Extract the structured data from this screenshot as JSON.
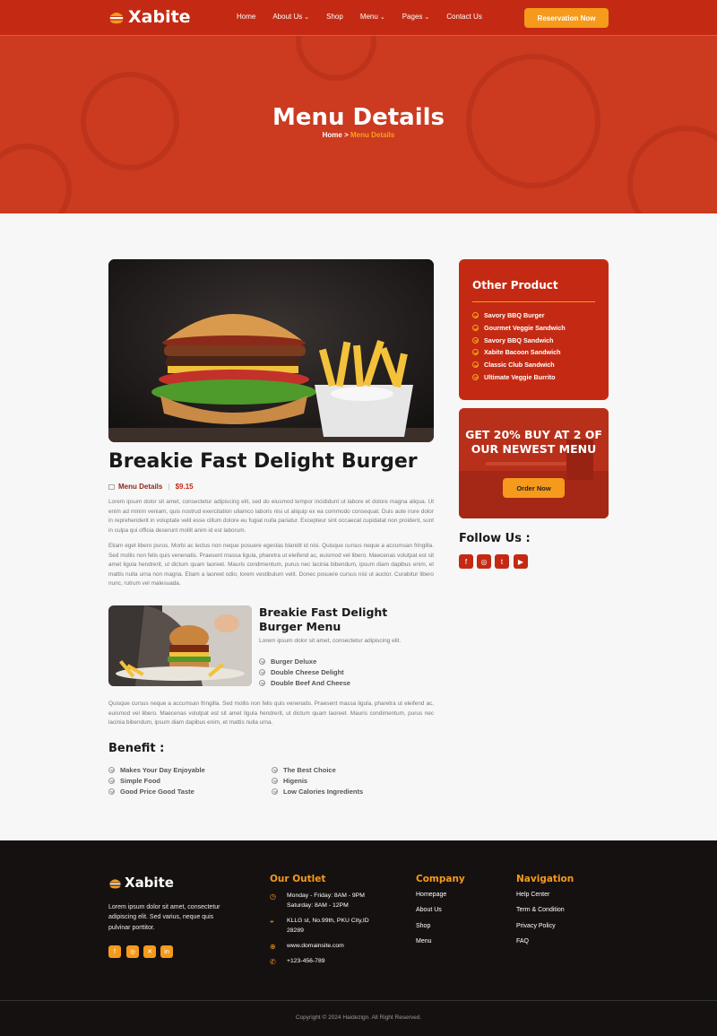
{
  "header": {
    "brand": "Xabite",
    "nav": [
      {
        "label": "Home",
        "dropdown": false
      },
      {
        "label": "About Us",
        "dropdown": true
      },
      {
        "label": "Shop",
        "dropdown": false
      },
      {
        "label": "Menu",
        "dropdown": true
      },
      {
        "label": "Pages",
        "dropdown": true
      },
      {
        "label": "Contact Us",
        "dropdown": false
      }
    ],
    "cta": "Reservation Now"
  },
  "hero": {
    "title": "Menu Details",
    "crumb_home": "Home",
    "crumb_sep": " > ",
    "crumb_current": "Menu Details"
  },
  "article": {
    "title": "Breakie Fast Delight Burger",
    "category": "Menu Details",
    "price": "$9.15",
    "para1": "Lorem ipsum dolor sit amet, consectetur adipiscing elit, sed do eiusmod tempor incididunt ut labore et dolore magna aliqua. Ut enim ad minim veniam, quis nostrud exercitation ullamco laboris nisi ut aliquip ex ea commodo consequat. Duis aute irure dolor in reprehenderit in voluptate velit esse cillum dolore eu fugiat nulla pariatur. Excepteur sint occaecat cupidatat non proident, sunt in culpa qui officia deserunt mollit anim id est laborum.",
    "para2": "Etiam eget libero purus. Morbi ac lectus non neque posuere egestas blandit id nisi. Quisque cursus neque a accumsan fringilla. Sed mollis non felis quis venenatis. Praesent massa ligula, pharetra ut eleifend ac, euismod vel libero. Maecenas volutpat est sit amet ligula hendrerit, ut dictum quam laoreet. Mauris condimentum, purus nec lacinia bibendum, ipsum diam dapibus enim, et mattis nulla urna non magna. Etiam a laoreet odio, lorem vestibulum velit. Donec posuere cursus nisi ut auctor. Curabitur libero nunc, rutrum vel malesuada.",
    "menu_title": "Breakie Fast Delight Burger Menu",
    "menu_desc": "Lorem ipsum dolor sit amet, consectetur adipiscing elit.",
    "menu_items": [
      "Burger Deluxe",
      "Double Cheese Delight",
      "Double Beef And Cheese"
    ],
    "para3": "Quisque cursus neque a accumsan fringilla. Sed mollis non felis quis venenatis. Praesent massa ligula, pharetra ut eleifend ac, euismod vel libero. Maecenas volutpat est sit amet ligula hendrerit, ut dictum quam laoreet. Mauris condimentum, purus nec lacinia bibendum, ipsum diam dapibus enim, et mattis nulla urna.",
    "benefit_title": "Benefit :",
    "benefits_left": [
      "Makes Your Day Enjoyable",
      "Simple Food",
      "Good Price Good Taste"
    ],
    "benefits_right": [
      "The Best Choice",
      "Higenis",
      "Low Calories Ingredients"
    ]
  },
  "sidebar": {
    "other_title": "Other Product",
    "products": [
      "Savory BBQ Burger",
      "Gourmet Veggie Sandwich",
      "Savory BBQ Sandwich",
      "Xabite Bacoon Sandwich",
      "Classic Club Sandwich",
      "Ultimate Veggie Burrito"
    ],
    "promo_text": "GET 20% BUY AT 2 OF OUR NEWEST MENU",
    "promo_btn": "Order Now",
    "follow_title": "Follow Us :",
    "socials": [
      "facebook-icon",
      "instagram-icon",
      "twitter-icon",
      "youtube-icon"
    ]
  },
  "footer": {
    "brand": "Xabite",
    "desc": "Lorem ipsum dolor sit amet, consectetur adipiscing elit. Sed varius, neque quis pulvinar porttitor.",
    "outlet_title": "Our Outlet",
    "hours1": "Monday - Friday: 8AM - 9PM",
    "hours2": "Saturday: 8AM - 12PM",
    "address1": "KLLG st, No.99th, PKU City,ID",
    "address2": "28289",
    "website": "www.domainsite.com",
    "phone": "+123-456-789",
    "company_title": "Company",
    "company_links": [
      "Homepage",
      "About Us",
      "Shop",
      "Menu"
    ],
    "nav_title": "Navigation",
    "nav_links": [
      "Help Center",
      "Term & Condition",
      "Privacy Policy",
      "FAQ"
    ],
    "copyright": "Copyright © 2024 Haidezign. All Right Reserved."
  },
  "colors": {
    "primary": "#c42a13",
    "accent": "#f59a1b",
    "footer_bg": "#161111"
  }
}
